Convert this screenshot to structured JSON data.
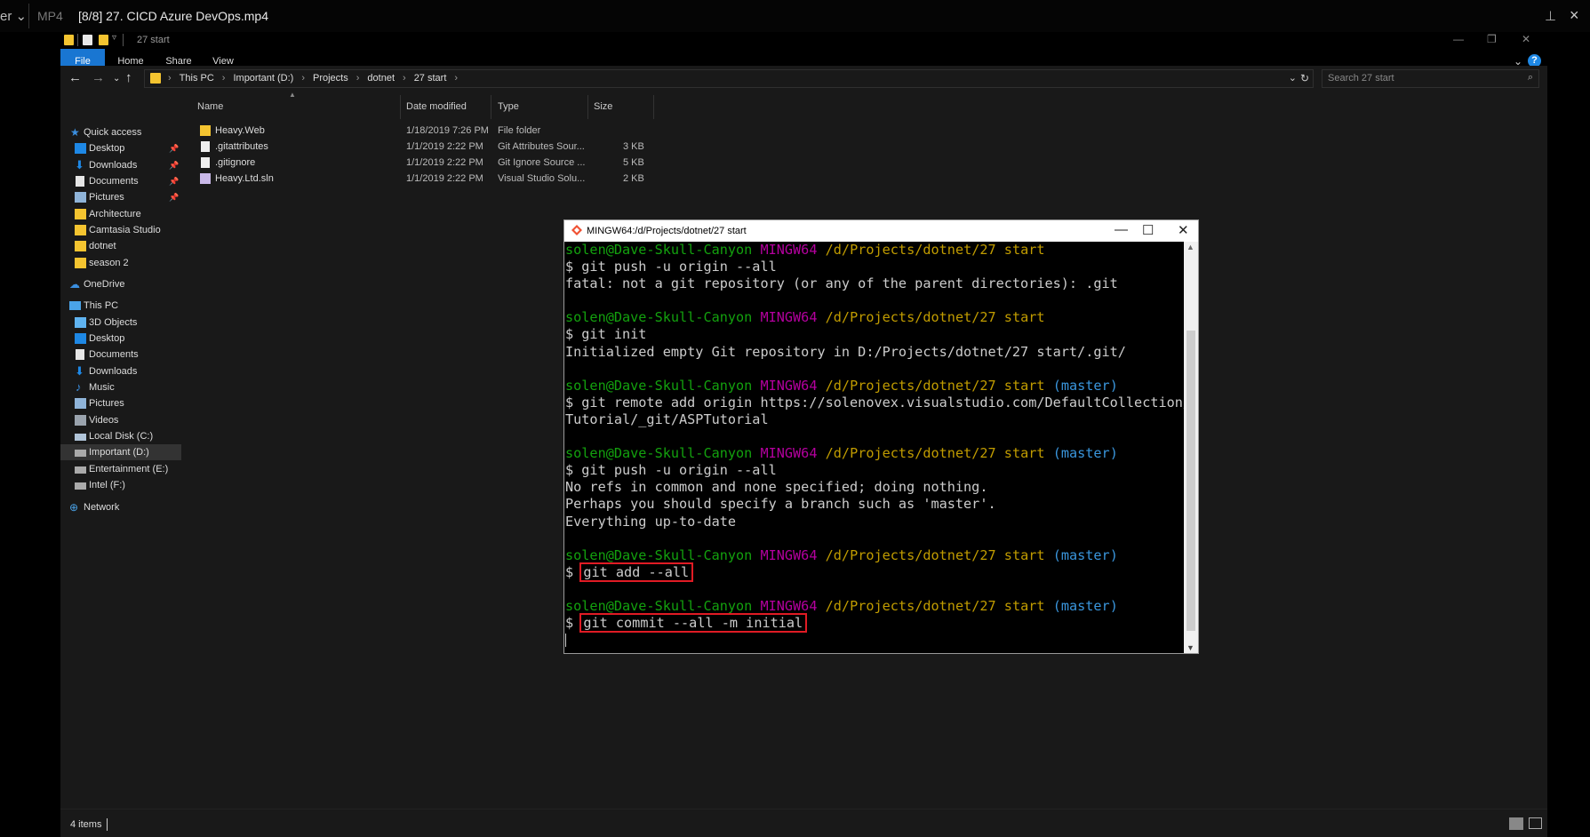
{
  "player": {
    "menu_label": "er ⌄",
    "format": "MP4",
    "title": "[8/8] 27. CICD Azure DevOps.mp4"
  },
  "explorer": {
    "window_title": "27 start",
    "ribbon_tabs": [
      "File",
      "Home",
      "Share",
      "View"
    ],
    "breadcrumb": [
      "This PC",
      "Important (D:)",
      "Projects",
      "dotnet",
      "27 start"
    ],
    "search_placeholder": "Search 27 start",
    "sidebar": {
      "quick_access": "Quick access",
      "quick_items": [
        "Desktop",
        "Downloads",
        "Documents",
        "Pictures",
        "Architecture",
        "Camtasia Studio",
        "dotnet",
        "season 2"
      ],
      "onedrive": "OneDrive",
      "this_pc": "This PC",
      "pc_items": [
        "3D Objects",
        "Desktop",
        "Documents",
        "Downloads",
        "Music",
        "Pictures",
        "Videos",
        "Local Disk (C:)",
        "Important (D:)",
        "Entertainment (E:)",
        "Intel (F:)"
      ],
      "network": "Network"
    },
    "columns": [
      "Name",
      "Date modified",
      "Type",
      "Size"
    ],
    "files": [
      {
        "name": "Heavy.Web",
        "date": "1/18/2019 7:26 PM",
        "type": "File folder",
        "size": "",
        "icon": "folder-icon"
      },
      {
        "name": ".gitattributes",
        "date": "1/1/2019 2:22 PM",
        "type": "Git Attributes Sour...",
        "size": "3 KB",
        "icon": "file-icon"
      },
      {
        "name": ".gitignore",
        "date": "1/1/2019 2:22 PM",
        "type": "Git Ignore Source ...",
        "size": "5 KB",
        "icon": "file-icon"
      },
      {
        "name": "Heavy.Ltd.sln",
        "date": "1/1/2019 2:22 PM",
        "type": "Visual Studio Solu...",
        "size": "2 KB",
        "icon": "solution-icon"
      }
    ],
    "status": "4 items"
  },
  "terminal": {
    "title": "MINGW64:/d/Projects/dotnet/27 start",
    "prompt_user": "solen@Dave-Skull-Canyon",
    "prompt_host": "MINGW64",
    "prompt_path": "/d/Projects/dotnet/27 start",
    "prompt_branch": "(master)",
    "lines": {
      "l2": "$ git push -u origin --all",
      "l3": "fatal: not a git repository (or any of the parent directories): .git",
      "l6": "$ git init",
      "l7": "Initialized empty Git repository in D:/Projects/dotnet/27 start/.git/",
      "l10": "$ git remote add origin https://solenovex.visualstudio.com/DefaultCollection/ASP",
      "l11": "Tutorial/_git/ASPTutorial",
      "l14": "$ git push -u origin --all",
      "l15": "No refs in common and none specified; doing nothing.",
      "l16": "Perhaps you should specify a branch such as 'master'.",
      "l17": "Everything up-to-date",
      "dollar": "$",
      "cmd_add": "git add --all",
      "cmd_commit": "git commit --all -m initial"
    }
  },
  "colors": {
    "accent": "#1976d2",
    "prompt_user": "#13a10e",
    "prompt_host": "#b4009e",
    "prompt_path": "#c19c00",
    "prompt_branch": "#3a96dd",
    "highlight_box": "#e01b24"
  }
}
